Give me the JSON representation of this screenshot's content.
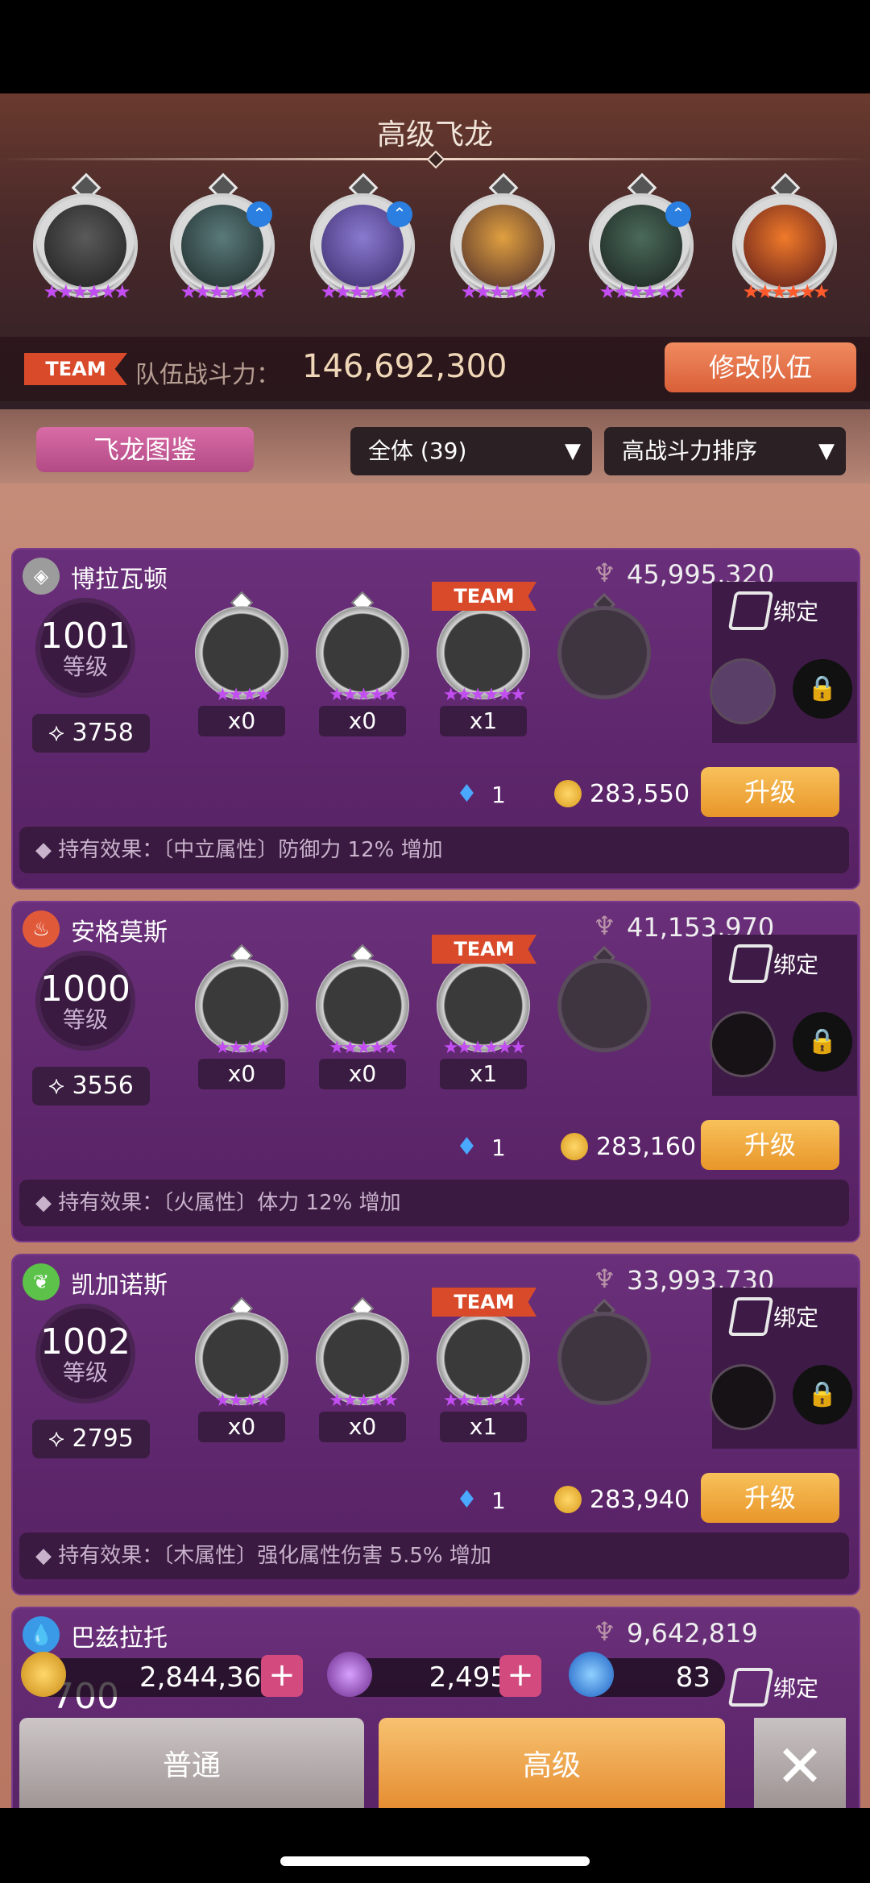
{
  "header": {
    "title": "高级飞龙",
    "team_badge": "TEAM",
    "power_label": "队伍战斗力：",
    "power_value": "146,692,300",
    "edit_button": "修改队伍",
    "team_slots": [
      {
        "star_color": "purple",
        "upgrade": false
      },
      {
        "star_color": "purple",
        "upgrade": true
      },
      {
        "star_color": "purple",
        "upgrade": true
      },
      {
        "star_color": "purple",
        "upgrade": false
      },
      {
        "star_color": "purple",
        "upgrade": true
      },
      {
        "star_color": "red",
        "upgrade": false
      }
    ]
  },
  "filters": {
    "codex_button": "飞龙图鉴",
    "filter_all": "全体 (39)",
    "sort": "高战斗力排序",
    "caret": "▼"
  },
  "cards": [
    {
      "element_icon": "neutral-icon",
      "element_color": "#9c9c9c",
      "name": "博拉瓦顿",
      "power": "45,995,320",
      "level": "1001",
      "level_label": "等级",
      "rank": "3758",
      "counts": [
        "x0",
        "x0",
        "x1"
      ],
      "team_tag": "TEAM",
      "bind_label": "绑定",
      "essence": "1",
      "coins": "283,550",
      "upgrade_label": "升级",
      "effect": "◆ 持有效果：〔中立属性〕防御力 12% 增加"
    },
    {
      "element_icon": "fire-icon",
      "element_color": "#e05a3a",
      "name": "安格莫斯",
      "power": "41,153,970",
      "level": "1000",
      "level_label": "等级",
      "rank": "3556",
      "counts": [
        "x0",
        "x0",
        "x1"
      ],
      "team_tag": "TEAM",
      "bind_label": "绑定",
      "essence": "1",
      "coins": "283,160",
      "upgrade_label": "升级",
      "effect": "◆ 持有效果：〔火属性〕体力 12% 增加"
    },
    {
      "element_icon": "leaf-icon",
      "element_color": "#5cc24a",
      "name": "凯加诺斯",
      "power": "33,993,730",
      "level": "1002",
      "level_label": "等级",
      "rank": "2795",
      "counts": [
        "x0",
        "x0",
        "x1"
      ],
      "team_tag": "TEAM",
      "bind_label": "绑定",
      "essence": "1",
      "coins": "283,940",
      "upgrade_label": "升级",
      "effect": "◆ 持有效果：〔木属性〕强化属性伤害 5.5% 增加"
    },
    {
      "element_icon": "water-icon",
      "element_color": "#3a9ae8",
      "name": "巴兹拉托",
      "power": "9,642,819",
      "level": "700",
      "bind_label": "绑定"
    }
  ],
  "currency": {
    "gold": "2,844,367",
    "gems": "2,495",
    "essence": "83",
    "plus": "+"
  },
  "tabs": {
    "normal": "普通",
    "advanced": "高级",
    "close": "✕"
  }
}
